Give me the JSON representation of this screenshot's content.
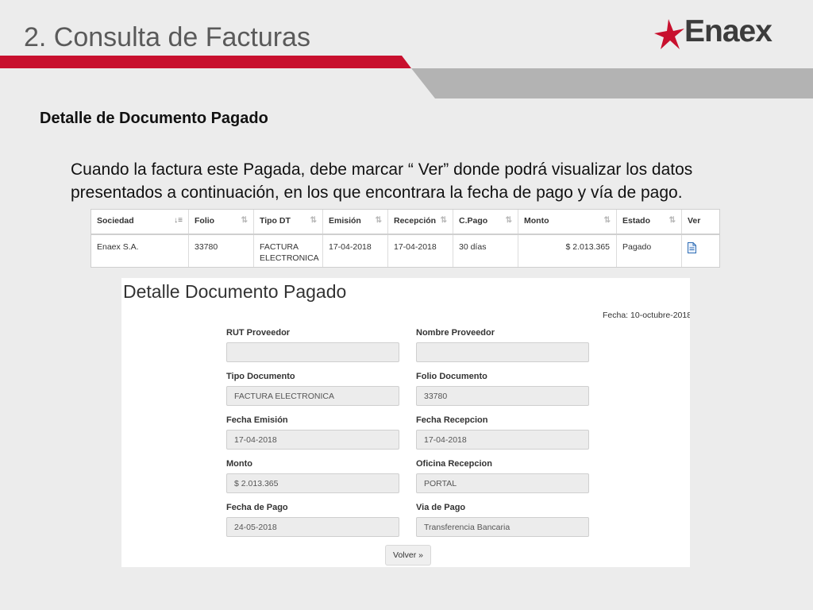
{
  "slide": {
    "title": "2. Consulta de Facturas",
    "logo_text": "Enaex",
    "brand_red": "#c8102e",
    "band_gray": "#b3b3b3"
  },
  "section_heading": "Detalle de Documento Pagado",
  "paragraph": "Cuando la factura este Pagada, debe marcar “ Ver” donde podrá visualizar los datos presentados a continuación, en los que encontrara la fecha de pago y vía de pago.",
  "table": {
    "columns": [
      "Sociedad",
      "Folio",
      "Tipo DT",
      "Emisión",
      "Recepción",
      "C.Pago",
      "Monto",
      "Estado",
      "Ver"
    ],
    "row": {
      "sociedad": "Enaex S.A.",
      "folio": "33780",
      "tipo_dt_line1": "FACTURA",
      "tipo_dt_line2": "ELECTRONICA",
      "emision": "17-04-2018",
      "recepcion": "17-04-2018",
      "c_pago": "30 días",
      "monto": "$ 2.013.365",
      "estado": "Pagado",
      "ver_icon": "document-icon"
    }
  },
  "detail": {
    "title": "Detalle Documento Pagado",
    "date": "Fecha: 10-octubre-2018",
    "fields": {
      "rut_proveedor": {
        "label": "RUT Proveedor",
        "value": ""
      },
      "nombre_proveedor": {
        "label": "Nombre Proveedor",
        "value": ""
      },
      "tipo_documento": {
        "label": "Tipo Documento",
        "value": "FACTURA ELECTRONICA"
      },
      "folio_documento": {
        "label": "Folio Documento",
        "value": "33780"
      },
      "fecha_emision": {
        "label": "Fecha Emisión",
        "value": "17-04-2018"
      },
      "fecha_recepcion": {
        "label": "Fecha Recepcion",
        "value": "17-04-2018"
      },
      "monto": {
        "label": "Monto",
        "value": "$ 2.013.365"
      },
      "oficina_recepcion": {
        "label": "Oficina Recepcion",
        "value": "PORTAL"
      },
      "fecha_pago": {
        "label": "Fecha de Pago",
        "value": "24-05-2018"
      },
      "via_pago": {
        "label": "Via de Pago",
        "value": "Transferencia Bancaria"
      }
    },
    "back_button": "Volver »"
  }
}
